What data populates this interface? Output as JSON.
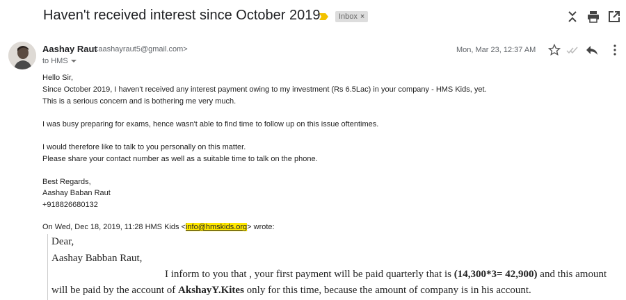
{
  "header": {
    "subject": "Haven't received interest since October 2019",
    "label": "Inbox",
    "label_remove": "×",
    "icons": [
      "expand-collapse-icon",
      "print-icon",
      "open-in-new-window-icon"
    ]
  },
  "message": {
    "sender_name": "Aashay Raut",
    "sender_email": "<aashayraut5@gmail.com>",
    "to": "to HMS",
    "date": "Mon, Mar 23, 12:37 AM",
    "body": [
      "Hello Sir,",
      "Since October 2019, I haven't received any interest payment owing to my investment (Rs 6.5Lac) in your company - HMS Kids, yet.",
      "This is a serious concern and is bothering me very much.",
      "I was busy preparing for exams, hence wasn't able to find time to follow up on this issue oftentimes.",
      "I would therefore like to talk to you personally on this matter.",
      "Please share your contact number as well as a suitable time to talk on the phone.",
      "Best Regards,",
      "Aashay Baban Raut",
      "+918826680132"
    ]
  },
  "quote": {
    "header_prefix": "On Wed, Dec 18, 2019, 11:28 HMS Kids <",
    "header_link": "info@hmskids.org",
    "header_suffix": "> wrote:",
    "greeting": "Dear,",
    "name": "Aashay Babban Raut,",
    "line1_a": "I inform to you that , your first payment will be paid quarterly that is ",
    "line1_b": "(14,300*3= 42,900)",
    "line1_c": " and this amount",
    "line2_a": "will be paid by the account of ",
    "line2_b": "AkshayY.Kites",
    "line2_c": " only for this time, because the amount of company is in his account."
  },
  "colors": {
    "important_marker": "#f2c200",
    "link_highlight": "#ffe800"
  }
}
